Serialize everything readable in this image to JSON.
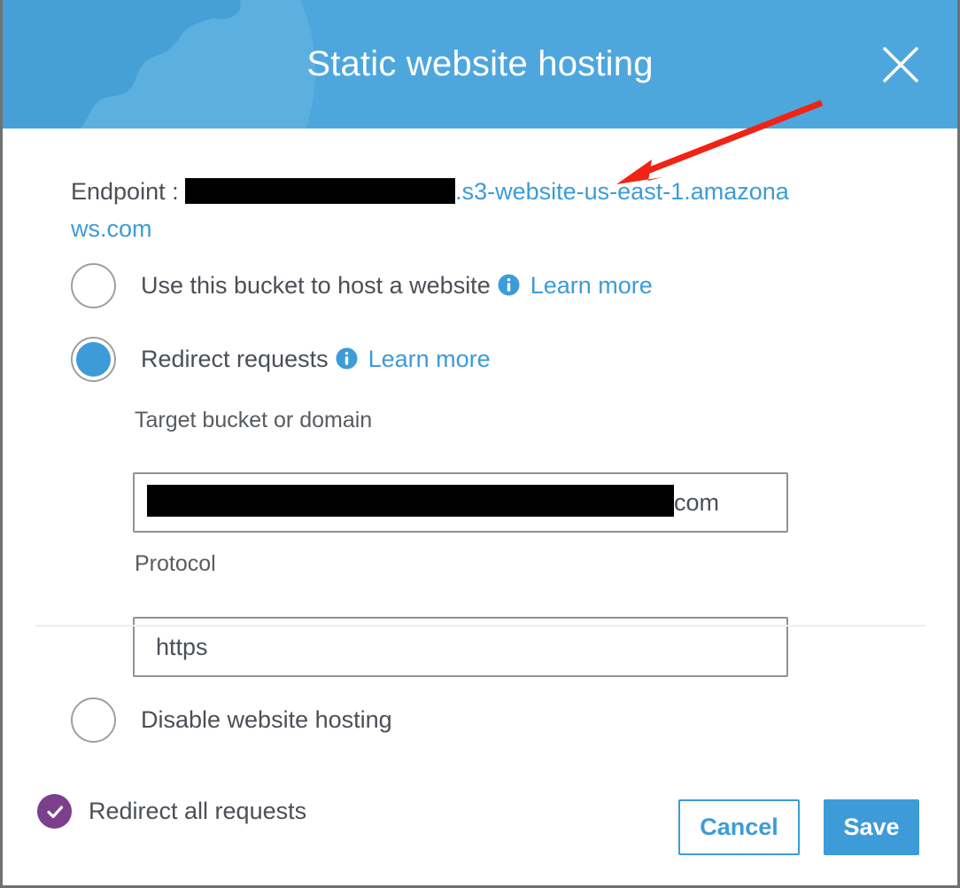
{
  "window": {
    "title": "Static website hosting",
    "close_icon": "close-x-icon",
    "header_color": "#4ea7dc",
    "accent_color": "#3d9bd8"
  },
  "endpoint": {
    "label": "Endpoint :",
    "redacted": true,
    "visible_url_part": ".s3-website-us-east-1.amazonaws.com"
  },
  "options": [
    {
      "id": "host-website",
      "label": "Use this bucket to host a website",
      "selected": false,
      "info_icon": "info-icon",
      "learn_more": "Learn more"
    },
    {
      "id": "redirect-requests",
      "label": "Redirect requests",
      "selected": true,
      "info_icon": "info-icon",
      "learn_more": "Learn more"
    },
    {
      "id": "disable-hosting",
      "label": "Disable website hosting",
      "selected": false
    }
  ],
  "fields": {
    "target_bucket": {
      "label": "Target bucket or domain",
      "value_redacted": true,
      "visible_value_tail": "com"
    },
    "protocol": {
      "label": "Protocol",
      "value": "https"
    }
  },
  "footer": {
    "status_text": "Redirect all requests",
    "status_icon": "check-circle-icon",
    "status_color": "#7b3f8c",
    "cancel_label": "Cancel",
    "save_label": "Save"
  },
  "annotation": {
    "arrow_color": "#f02314",
    "points_to": "endpoint-url"
  }
}
